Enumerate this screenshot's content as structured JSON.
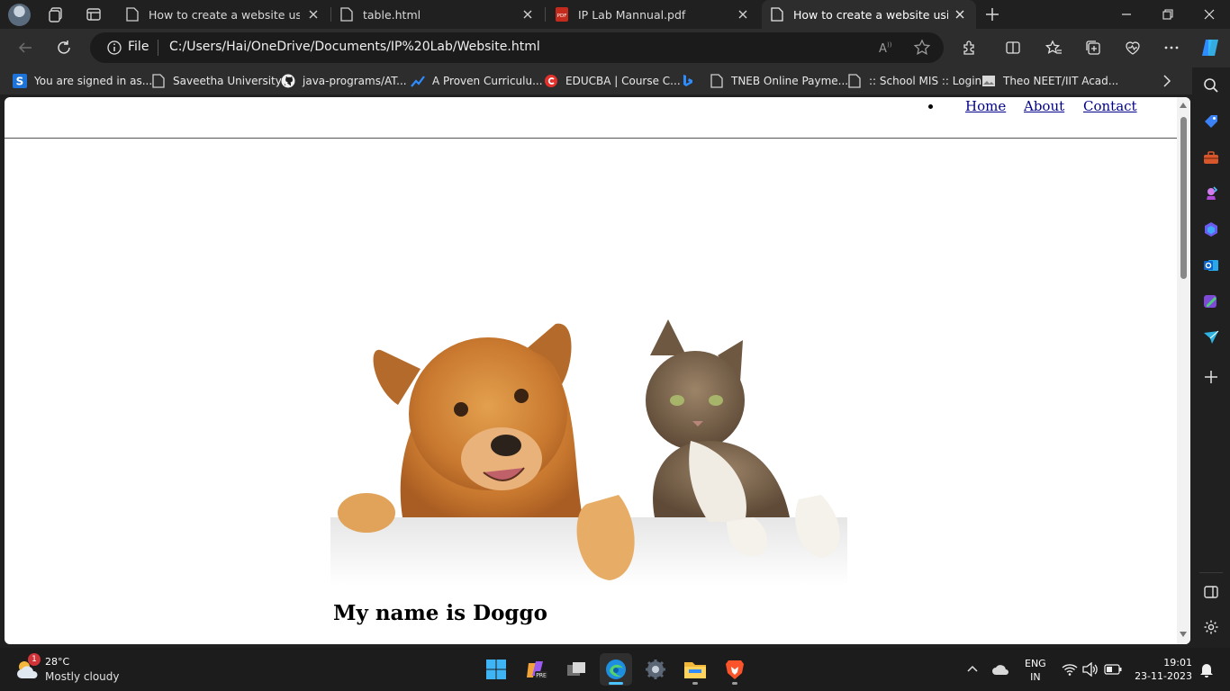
{
  "tabs": [
    {
      "title": "How to create a website using HTML",
      "active": false,
      "favicon": "page-icon"
    },
    {
      "title": "table.html",
      "active": false,
      "favicon": "page-icon"
    },
    {
      "title": "IP Lab Mannual.pdf",
      "active": false,
      "favicon": "pdf-icon"
    },
    {
      "title": "How to create a website using HTML",
      "active": true,
      "favicon": "page-icon"
    }
  ],
  "address_bar": {
    "scheme_label": "File",
    "url": "C:/Users/Hai/OneDrive/Documents/IP%20Lab/Website.html"
  },
  "favorites": [
    {
      "label": "You are signed in as...",
      "icon": "s-logo-icon"
    },
    {
      "label": "Saveetha University",
      "icon": "page-icon"
    },
    {
      "label": "java-programs/AT...",
      "icon": "github-icon"
    },
    {
      "label": "A Proven Curriculu...",
      "icon": "chart-icon"
    },
    {
      "label": "EDUCBA | Course C...",
      "icon": "educba-icon"
    },
    {
      "label": "",
      "icon": "bing-icon"
    },
    {
      "label": "TNEB Online Payme...",
      "icon": "page-icon"
    },
    {
      "label": ":: School MIS :: Login",
      "icon": "page-icon"
    },
    {
      "label": "Theo NEET/IIT Acad...",
      "icon": "image-icon"
    }
  ],
  "webpage": {
    "nav_links": [
      "Home",
      "About",
      "Contact"
    ],
    "hero_alt": "dog and cat",
    "caption": "My name is Doggo"
  },
  "taskbar": {
    "weather": {
      "temp": "28°C",
      "condition": "Mostly cloudy",
      "badge": "1"
    },
    "language": {
      "line1": "ENG",
      "line2": "IN"
    },
    "clock": {
      "time": "19:01",
      "date": "23-11-2023"
    }
  },
  "colors": {
    "browser_dark": "#202020",
    "toolbar": "#2d2d2d",
    "link": "#00008b",
    "accent": "#4cc2ff"
  }
}
